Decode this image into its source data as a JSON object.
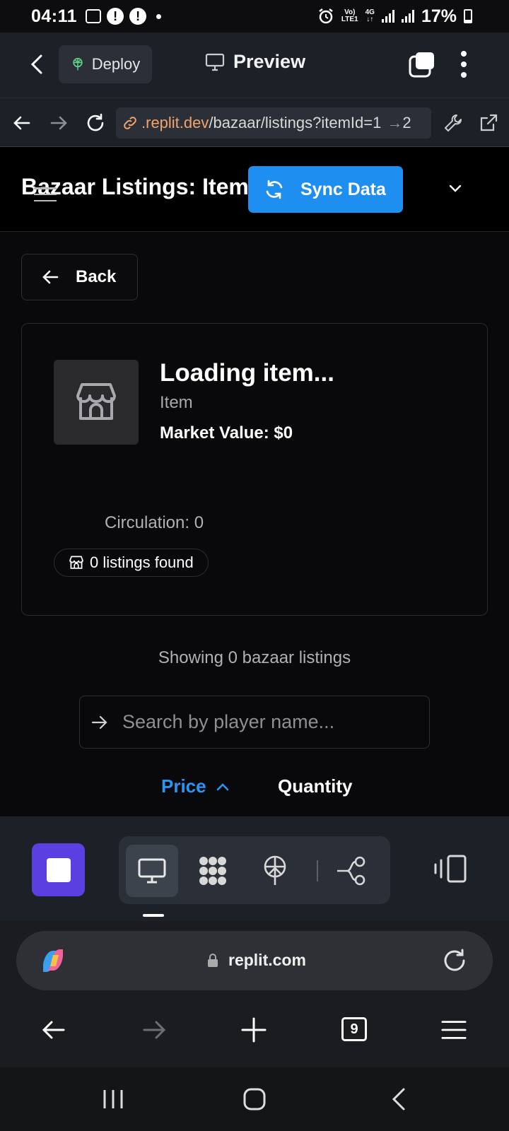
{
  "status_bar": {
    "time": "04:11",
    "net_top": "Vo)",
    "net_bottom": "LTE1",
    "net_type": "4G",
    "battery": "17%"
  },
  "replit_header": {
    "deploy_label": "Deploy",
    "preview_label": "Preview"
  },
  "url_bar": {
    "host": ".replit.dev",
    "path": "/bazaar/listings?itemId=1",
    "trailing": "2"
  },
  "page_header": {
    "title": "Bazaar Listings: Item",
    "sync_label": "Sync Data"
  },
  "main": {
    "back_label": "Back",
    "item_name": "Loading item...",
    "item_type": "Item",
    "market_value": "Market Value: $0",
    "circulation": "Circulation: 0",
    "listings_found": "0 listings found",
    "showing_text": "Showing 0 bazaar listings",
    "search_placeholder": "Search by player name...",
    "sort_price": "Price",
    "sort_quantity": "Quantity"
  },
  "browser": {
    "domain": "replit.com",
    "tab_count": "9"
  },
  "colors": {
    "accent_blue": "#1e8ff0",
    "stop_purple": "#5b3fe0",
    "url_host_orange": "#f2a36b"
  }
}
